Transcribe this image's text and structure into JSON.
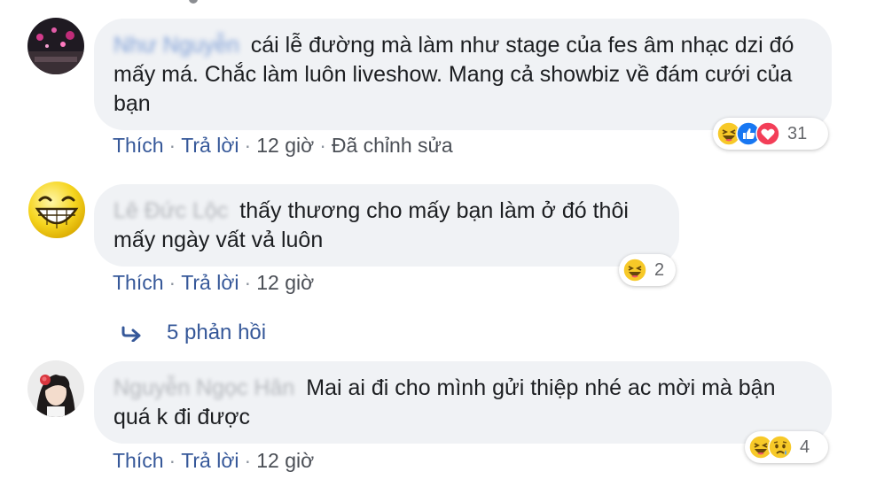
{
  "comments": [
    {
      "author": "Như Nguyễn",
      "text": "cái lễ đường mà làm như stage của fes âm nhạc dzi đó mấy má. Chắc làm luôn liveshow. Mang cả showbiz về đám cưới của bạn",
      "like_label": "Thích",
      "reply_label": "Trả lời",
      "time": "12 giờ",
      "edited": "Đã chỉnh sửa",
      "reaction_icons": [
        "haha-icon",
        "like-icon",
        "love-icon"
      ],
      "reaction_count": "31"
    },
    {
      "author": "Lê Đức Lộc",
      "text": "thấy thương cho mấy bạn làm ở đó thôi mấy ngày vất vả luôn",
      "like_label": "Thích",
      "reply_label": "Trả lời",
      "time": "12 giờ",
      "reaction_icons": [
        "haha-icon"
      ],
      "reaction_count": "2",
      "replies_label": "5 phản hồi"
    },
    {
      "author": "Nguyễn Ngọc Hân",
      "text": "Mai ai đi cho mình gửi thiệp nhé ac mời mà bận quá k đi được",
      "like_label": "Thích",
      "reply_label": "Trả lời",
      "time": "12 giờ",
      "reaction_icons": [
        "haha-icon",
        "sad-icon"
      ],
      "reaction_count": "4"
    }
  ],
  "colors": {
    "bubble": "#f0f2f5",
    "link": "#365899",
    "meta": "#4b4f56"
  }
}
